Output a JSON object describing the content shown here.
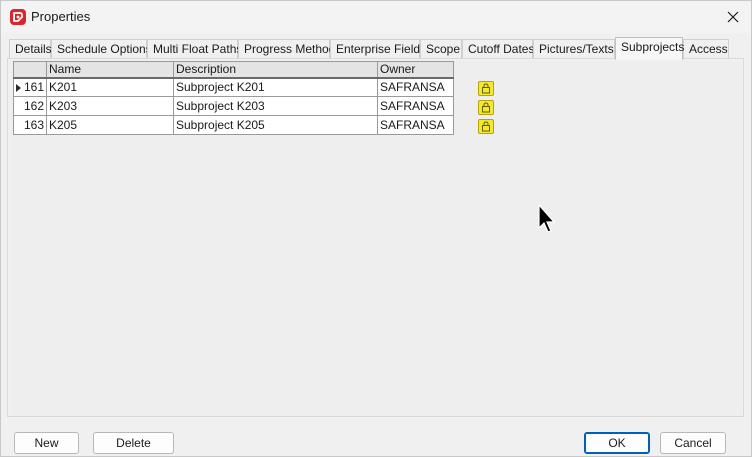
{
  "window": {
    "title": "Properties",
    "icons": {
      "app": "app-logo-icon",
      "close": "close-icon"
    }
  },
  "tabs": [
    {
      "label": "Details",
      "active": false
    },
    {
      "label": "Schedule Options",
      "active": false
    },
    {
      "label": "Multi Float Paths",
      "active": false
    },
    {
      "label": "Progress Method",
      "active": false
    },
    {
      "label": "Enterprise Fields",
      "active": false
    },
    {
      "label": "Scope",
      "active": false
    },
    {
      "label": "Cutoff Dates",
      "active": false
    },
    {
      "label": "Pictures/Texts",
      "active": false
    },
    {
      "label": "Subprojects",
      "active": true
    },
    {
      "label": "Access",
      "active": false
    }
  ],
  "grid": {
    "columns": {
      "name": "Name",
      "description": "Description",
      "owner": "Owner"
    },
    "rows": [
      {
        "id": "161",
        "name": "K201",
        "description": "Subproject K201",
        "owner": "SAFRANSA",
        "current": true
      },
      {
        "id": "162",
        "name": "K203",
        "description": "Subproject K203",
        "owner": "SAFRANSA",
        "current": false
      },
      {
        "id": "163",
        "name": "K205",
        "description": "Subproject K205",
        "owner": "SAFRANSA",
        "current": false
      }
    ],
    "row_icon": "lock-icon",
    "lock_color": "#f2e933"
  },
  "buttons": {
    "new": "New",
    "delete": "Delete",
    "ok": "OK",
    "cancel": "Cancel"
  },
  "colors": {
    "accent": "#005fb8",
    "app_icon": "#d9262c"
  }
}
